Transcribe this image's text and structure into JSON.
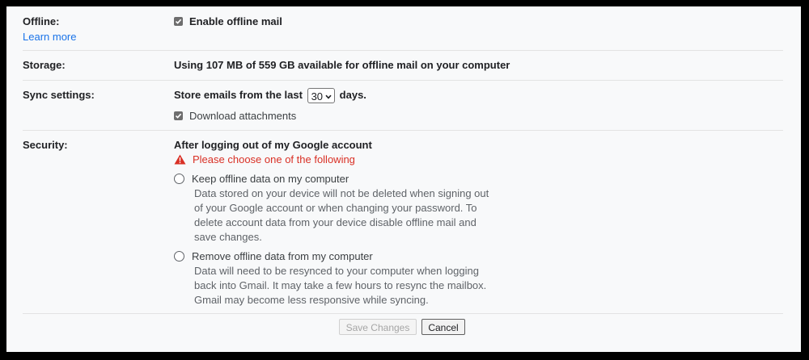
{
  "offline": {
    "label": "Offline:",
    "learn_more": "Learn more",
    "enable_label": "Enable offline mail",
    "enabled": true
  },
  "storage": {
    "label": "Storage:",
    "text": "Using 107 MB of 559 GB available for offline mail on your computer"
  },
  "sync": {
    "label": "Sync settings:",
    "prefix": "Store emails from the last",
    "days_value": "30",
    "suffix": "days.",
    "attachments_label": "Download attachments",
    "attachments_checked": true
  },
  "security": {
    "label": "Security:",
    "heading": "After logging out of my Google account",
    "warning": "Please choose one of the following",
    "options": [
      {
        "label": "Keep offline data on my computer",
        "desc": "Data stored on your device will not be deleted when signing out of your Google account or when changing your password. To delete account data from your device disable offline mail and save changes."
      },
      {
        "label": "Remove offline data from my computer",
        "desc": "Data will need to be resynced to your computer when logging back into Gmail. It may take a few hours to resync the mailbox. Gmail may become less responsive while syncing."
      }
    ]
  },
  "buttons": {
    "save": "Save Changes",
    "cancel": "Cancel"
  },
  "colors": {
    "link": "#1a73e8",
    "warning": "#d93025",
    "background": "#f8f9fa"
  }
}
